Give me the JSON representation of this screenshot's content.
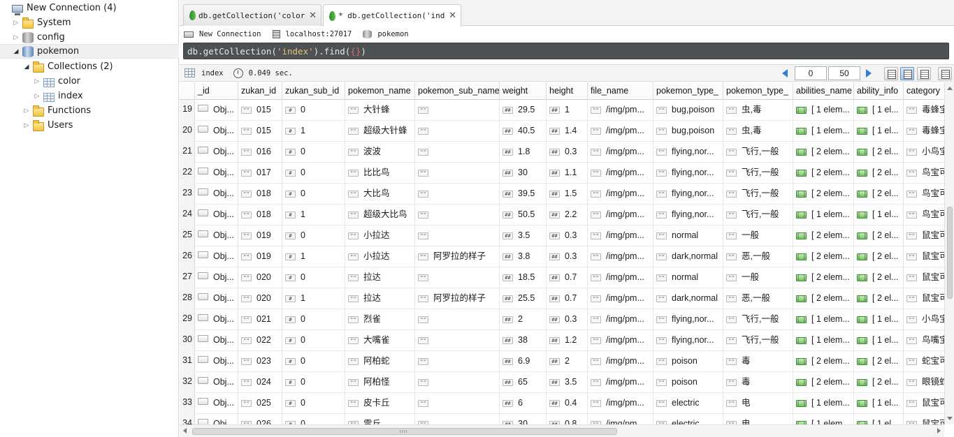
{
  "sidebar": {
    "connection": "New Connection (4)",
    "items": [
      {
        "label": "System"
      },
      {
        "label": "config"
      },
      {
        "label": "pokemon"
      },
      {
        "label": "Collections (2)"
      },
      {
        "label": "color"
      },
      {
        "label": "index"
      },
      {
        "label": "Functions"
      },
      {
        "label": "Users"
      }
    ]
  },
  "tabs": [
    {
      "label": "db.getCollection('color')⋯"
    },
    {
      "label": "* db.getCollection('index⋯"
    }
  ],
  "info": {
    "connection": "New Connection",
    "server": "localhost:27017",
    "database": "pokemon"
  },
  "query": {
    "prefix": "db.getCollection(",
    "string": "'index'",
    "middle": ").find(",
    "braces": "{}",
    "suffix": ")"
  },
  "result_toolbar": {
    "collection": "index",
    "time": "0.049 sec.",
    "skip": "0",
    "limit": "50"
  },
  "columns": [
    "_id",
    "zukan_id",
    "zukan_sub_id",
    "pokemon_name",
    "pokemon_sub_name",
    "weight",
    "height",
    "file_name",
    "pokemon_type_",
    "pokemon_type_",
    "abilities_name",
    "ability_info",
    "category"
  ],
  "rows": [
    {
      "n": "19",
      "id": "Obj...",
      "zukan": "015",
      "sub": "0",
      "name": "大针蜂",
      "subname": "",
      "weight": "29.5",
      "height": "1",
      "file": "/img/pm...",
      "type_en": "bug,poison",
      "type_cn": "虫,毒",
      "abil": "[ 1 elem...",
      "info": "[ 1 el...",
      "cat": "毒蜂宝"
    },
    {
      "n": "20",
      "id": "Obj...",
      "zukan": "015",
      "sub": "1",
      "name": "超级大针蜂",
      "subname": "",
      "weight": "40.5",
      "height": "1.4",
      "file": "/img/pm...",
      "type_en": "bug,poison",
      "type_cn": "虫,毒",
      "abil": "[ 1 elem...",
      "info": "[ 1 el...",
      "cat": "毒蜂宝"
    },
    {
      "n": "21",
      "id": "Obj...",
      "zukan": "016",
      "sub": "0",
      "name": "波波",
      "subname": "",
      "weight": "1.8",
      "height": "0.3",
      "file": "/img/pm...",
      "type_en": "flying,nor...",
      "type_cn": "飞行,一般",
      "abil": "[ 2 elem...",
      "info": "[ 2 el...",
      "cat": "小鸟宝"
    },
    {
      "n": "22",
      "id": "Obj...",
      "zukan": "017",
      "sub": "0",
      "name": "比比鸟",
      "subname": "",
      "weight": "30",
      "height": "1.1",
      "file": "/img/pm...",
      "type_en": "flying,nor...",
      "type_cn": "飞行,一般",
      "abil": "[ 2 elem...",
      "info": "[ 2 el...",
      "cat": "鸟宝可"
    },
    {
      "n": "23",
      "id": "Obj...",
      "zukan": "018",
      "sub": "0",
      "name": "大比鸟",
      "subname": "",
      "weight": "39.5",
      "height": "1.5",
      "file": "/img/pm...",
      "type_en": "flying,nor...",
      "type_cn": "飞行,一般",
      "abil": "[ 2 elem...",
      "info": "[ 2 el...",
      "cat": "鸟宝可"
    },
    {
      "n": "24",
      "id": "Obj...",
      "zukan": "018",
      "sub": "1",
      "name": "超级大比鸟",
      "subname": "",
      "weight": "50.5",
      "height": "2.2",
      "file": "/img/pm...",
      "type_en": "flying,nor...",
      "type_cn": "飞行,一般",
      "abil": "[ 1 elem...",
      "info": "[ 1 el...",
      "cat": "鸟宝可"
    },
    {
      "n": "25",
      "id": "Obj...",
      "zukan": "019",
      "sub": "0",
      "name": "小拉达",
      "subname": "",
      "weight": "3.5",
      "height": "0.3",
      "file": "/img/pm...",
      "type_en": "normal",
      "type_cn": "一般",
      "abil": "[ 2 elem...",
      "info": "[ 2 el...",
      "cat": "鼠宝可"
    },
    {
      "n": "26",
      "id": "Obj...",
      "zukan": "019",
      "sub": "1",
      "name": "小拉达",
      "subname": "阿罗拉的样子",
      "weight": "3.8",
      "height": "0.3",
      "file": "/img/pm...",
      "type_en": "dark,normal",
      "type_cn": "恶,一般",
      "abil": "[ 2 elem...",
      "info": "[ 2 el...",
      "cat": "鼠宝可"
    },
    {
      "n": "27",
      "id": "Obj...",
      "zukan": "020",
      "sub": "0",
      "name": "拉达",
      "subname": "",
      "weight": "18.5",
      "height": "0.7",
      "file": "/img/pm...",
      "type_en": "normal",
      "type_cn": "一般",
      "abil": "[ 2 elem...",
      "info": "[ 2 el...",
      "cat": "鼠宝可"
    },
    {
      "n": "28",
      "id": "Obj...",
      "zukan": "020",
      "sub": "1",
      "name": "拉达",
      "subname": "阿罗拉的样子",
      "weight": "25.5",
      "height": "0.7",
      "file": "/img/pm...",
      "type_en": "dark,normal",
      "type_cn": "恶,一般",
      "abil": "[ 2 elem...",
      "info": "[ 2 el...",
      "cat": "鼠宝可"
    },
    {
      "n": "29",
      "id": "Obj...",
      "zukan": "021",
      "sub": "0",
      "name": "烈雀",
      "subname": "",
      "weight": "2",
      "height": "0.3",
      "file": "/img/pm...",
      "type_en": "flying,nor...",
      "type_cn": "飞行,一般",
      "abil": "[ 1 elem...",
      "info": "[ 1 el...",
      "cat": "小鸟宝"
    },
    {
      "n": "30",
      "id": "Obj...",
      "zukan": "022",
      "sub": "0",
      "name": "大嘴雀",
      "subname": "",
      "weight": "38",
      "height": "1.2",
      "file": "/img/pm...",
      "type_en": "flying,nor...",
      "type_cn": "飞行,一般",
      "abil": "[ 1 elem...",
      "info": "[ 1 el...",
      "cat": "鸟嘴宝"
    },
    {
      "n": "31",
      "id": "Obj...",
      "zukan": "023",
      "sub": "0",
      "name": "阿柏蛇",
      "subname": "",
      "weight": "6.9",
      "height": "2",
      "file": "/img/pm...",
      "type_en": "poison",
      "type_cn": "毒",
      "abil": "[ 2 elem...",
      "info": "[ 2 el...",
      "cat": "蛇宝可"
    },
    {
      "n": "32",
      "id": "Obj...",
      "zukan": "024",
      "sub": "0",
      "name": "阿柏怪",
      "subname": "",
      "weight": "65",
      "height": "3.5",
      "file": "/img/pm...",
      "type_en": "poison",
      "type_cn": "毒",
      "abil": "[ 2 elem...",
      "info": "[ 2 el...",
      "cat": "眼镜蛇"
    },
    {
      "n": "33",
      "id": "Obj...",
      "zukan": "025",
      "sub": "0",
      "name": "皮卡丘",
      "subname": "",
      "weight": "6",
      "height": "0.4",
      "file": "/img/pm...",
      "type_en": "electric",
      "type_cn": "电",
      "abil": "[ 1 elem...",
      "info": "[ 1 el...",
      "cat": "鼠宝可"
    },
    {
      "n": "34",
      "id": "Obj...",
      "zukan": "026",
      "sub": "0",
      "name": "雷丘",
      "subname": "",
      "weight": "30",
      "height": "0.8",
      "file": "/img/pm...",
      "type_en": "electric",
      "type_cn": "电",
      "abil": "[ 1 elem...",
      "info": "[ 1 el...",
      "cat": "鼠宝可"
    }
  ]
}
